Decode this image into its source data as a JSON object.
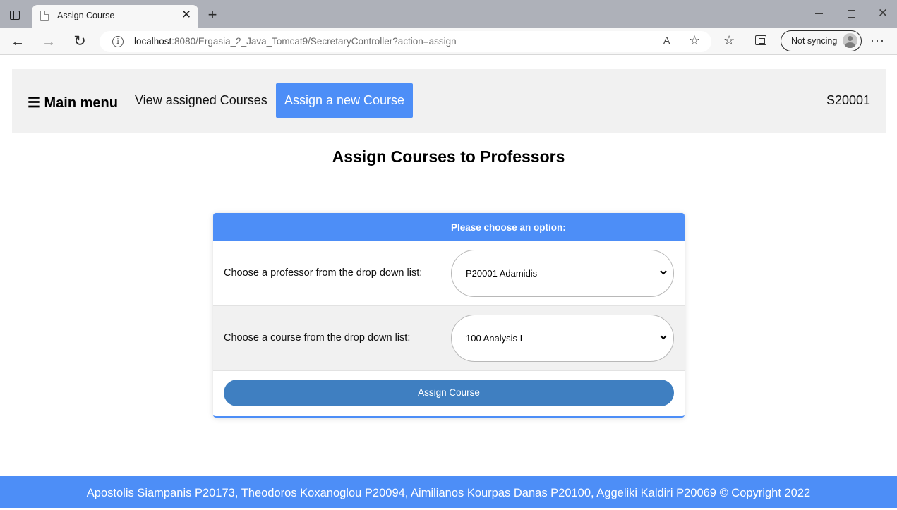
{
  "browser": {
    "tab_title": "Assign Course",
    "tab_close": "✕",
    "new_tab": "+",
    "url_host": "localhost",
    "url_rest": ":8080/Ergasia_2_Java_Tomcat9/SecretaryController?action=assign",
    "sync_label": "Not syncing",
    "back": "←",
    "forward": "→",
    "reload": "↻",
    "read_aloud": "A",
    "favorite": "☆",
    "favorites": "☆",
    "more": "···",
    "close_window": "✕",
    "info": "i"
  },
  "navbar": {
    "menu_label": "☰ Main menu",
    "link_view": "View assigned Courses",
    "link_assign": "Assign a new Course",
    "user_id": "S20001"
  },
  "main": {
    "title": "Assign Courses to Professors"
  },
  "form": {
    "header": "Please choose an option:",
    "professor_label": "Choose a professor from the drop down list:",
    "professor_selected": "P20001 Adamidis",
    "course_label": "Choose a course from the drop down list:",
    "course_selected": "100 Analysis I",
    "submit_label": "Assign Course"
  },
  "footer": {
    "text": "Apostolis Siampanis P20173, Theodoros Koxanoglou P20094, Aimilianos Kourpas Danas P20100, Aggeliki Kaldiri P20069 © Copyright 2022"
  },
  "colors": {
    "accent": "#4d8ef7",
    "submit": "#3f7fc1",
    "navbar_bg": "#f1f1f1"
  }
}
